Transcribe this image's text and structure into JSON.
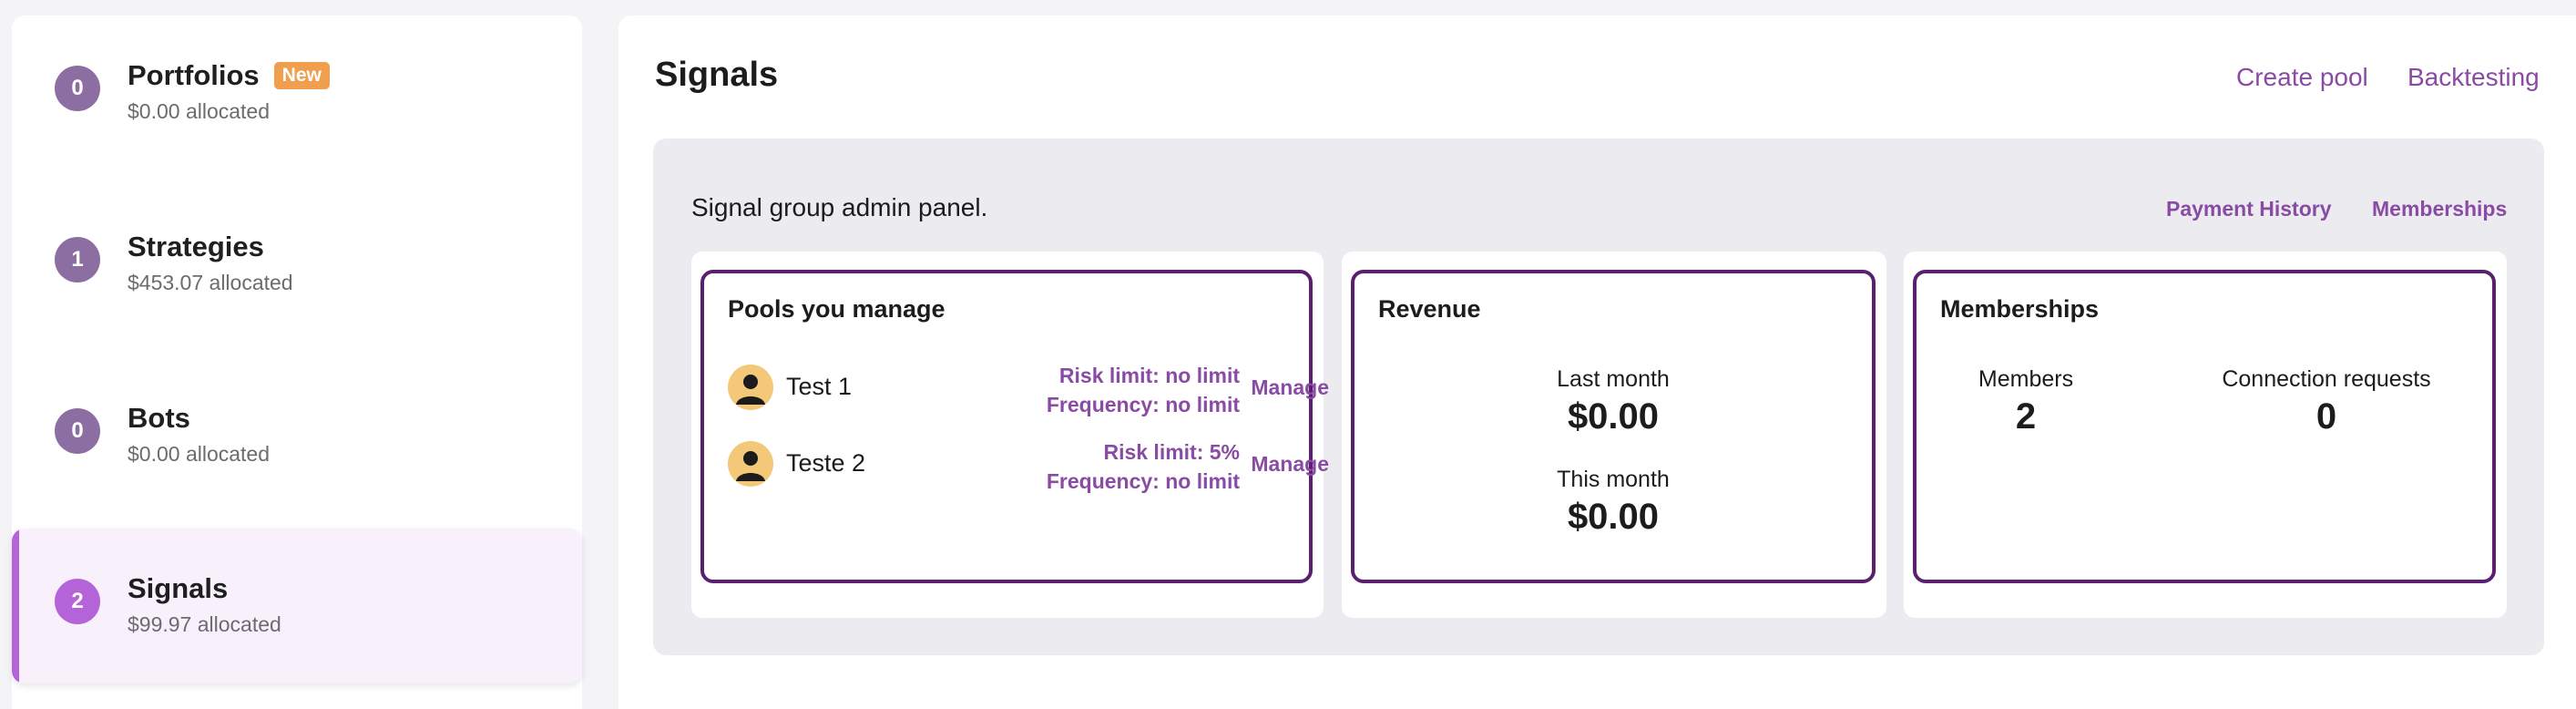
{
  "sidebar": {
    "items": [
      {
        "count": "0",
        "title": "Portfolios",
        "badge": "New",
        "allocated": "$0.00 allocated"
      },
      {
        "count": "1",
        "title": "Strategies",
        "allocated": "$453.07 allocated"
      },
      {
        "count": "0",
        "title": "Bots",
        "allocated": "$0.00 allocated"
      },
      {
        "count": "2",
        "title": "Signals",
        "allocated": "$99.97 allocated"
      }
    ],
    "active_item": "Signals"
  },
  "header": {
    "title": "Signals",
    "create_pool": "Create pool",
    "backtesting": "Backtesting"
  },
  "panel": {
    "description": "Signal group admin panel.",
    "payment_history": "Payment History",
    "memberships_link": "Memberships"
  },
  "pools_card": {
    "title": "Pools you manage",
    "pools": [
      {
        "name": "Test 1",
        "risk": "Risk limit: no limit",
        "frequency": "Frequency: no limit",
        "action": "Manage"
      },
      {
        "name": "Teste 2",
        "risk": "Risk limit: 5%",
        "frequency": "Frequency: no limit",
        "action": "Manage"
      }
    ]
  },
  "revenue_card": {
    "title": "Revenue",
    "last_month_label": "Last month",
    "last_month_value": "$0.00",
    "this_month_label": "This month",
    "this_month_value": "$0.00"
  },
  "memberships_card": {
    "title": "Memberships",
    "members_label": "Members",
    "members_value": "2",
    "requests_label": "Connection requests",
    "requests_value": "0"
  },
  "colors": {
    "accent": "#8a4ba4",
    "active": "#b464d8",
    "card_border": "#5a1f6e",
    "new_badge": "#f09f4e",
    "avatar": "#f3c979"
  },
  "icons": {
    "avatar": "user-avatar-icon"
  }
}
